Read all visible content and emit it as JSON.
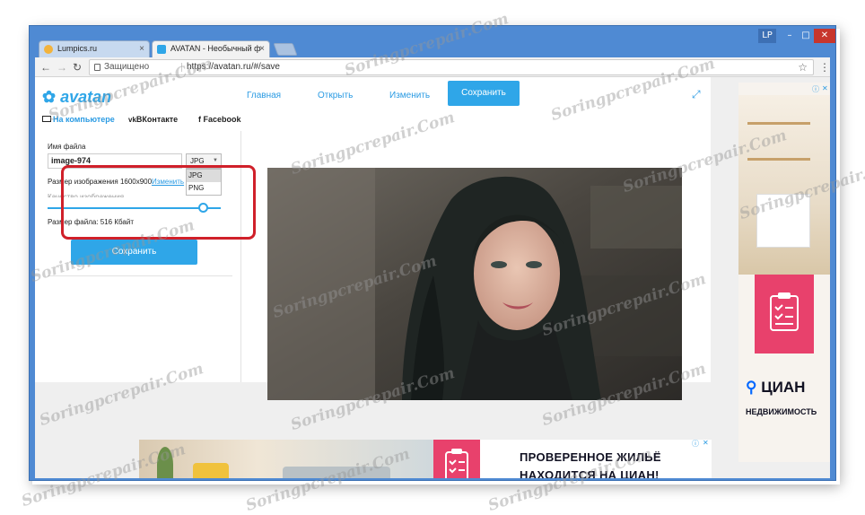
{
  "window": {
    "profile_badge": "LP",
    "minimize": "–",
    "maximize": "□",
    "close": "✕"
  },
  "tabs": [
    {
      "title": "Lumpics.ru",
      "close": "×"
    },
    {
      "title": "AVATAN - Необычный ф",
      "close": "×"
    }
  ],
  "toolbar": {
    "back": "←",
    "forward": "→",
    "reload": "↻",
    "secure_label": "Защищено",
    "url": "https://avatan.ru/#/save",
    "star": "☆",
    "menu": "⋮"
  },
  "app": {
    "logo_text": "avatan",
    "nav": {
      "home": "Главная",
      "open": "Открыть",
      "edit": "Изменить",
      "save": "Сохранить"
    },
    "expand_icon": "⤢",
    "sources": {
      "computer": "На компьютере",
      "vk": "ВКонтакте",
      "facebook": "Facebook"
    }
  },
  "save_panel": {
    "filename_label": "Имя файла",
    "filename_value": "image-974",
    "format_selected": "JPG",
    "format_options": [
      "JPG",
      "PNG"
    ],
    "image_size_text": "Размер изображения 1600x900",
    "change_link": "Изменить",
    "quality_label": "Качество изображения",
    "quality_value": 0.9,
    "file_size_text": "Размер файла: 516 Кбайт",
    "save_button": "Сохранить"
  },
  "ads": {
    "right": {
      "brand": "ЦИАН",
      "tagline": "НЕДВИЖИМОСТЬ"
    },
    "bottom": {
      "line1": "ПРОВЕРЕННОЕ ЖИЛЬЁ",
      "line2": "НАХОДИТСЯ НА ЦИАН!"
    },
    "ad_choice_icon": "ⓘ",
    "ad_close": "✕"
  },
  "watermark_text": "Soringpcrepair.Com",
  "colors": {
    "accent": "#2fa6e8",
    "highlight_frame": "#d0202a",
    "titlebar": "#4f8ad3",
    "cian_pink": "#e8416c",
    "cian_blue": "#0468ff"
  }
}
